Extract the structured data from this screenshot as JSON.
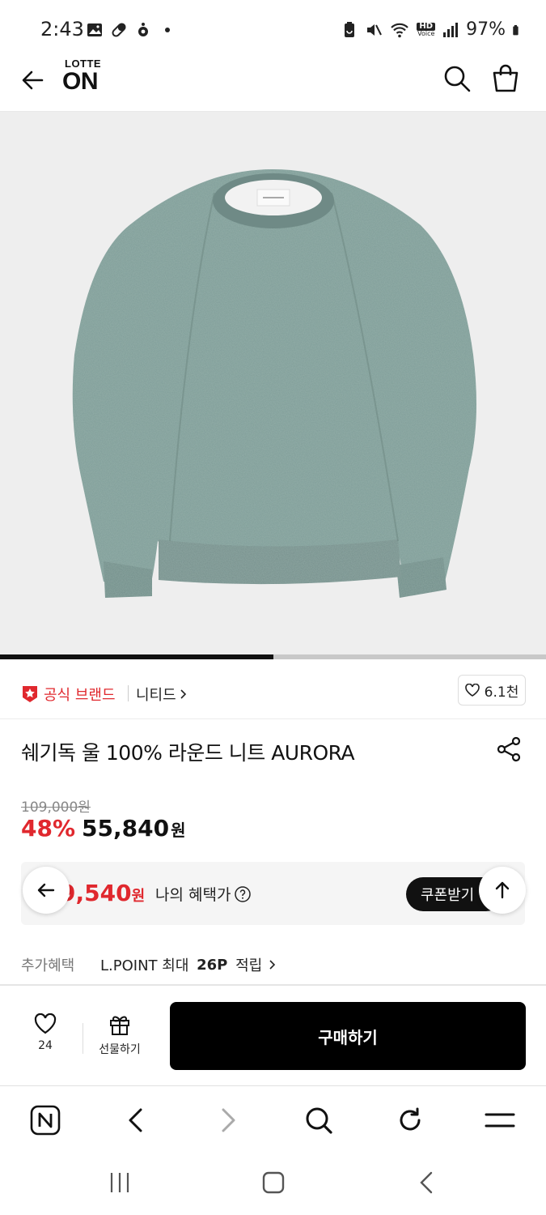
{
  "status_bar": {
    "time": "2:43",
    "battery": "97%",
    "icons": [
      "gallery-icon",
      "pill-icon",
      "app-notification-icon",
      "dot-icon",
      "battery-saver-icon",
      "mute-icon",
      "wifi-icon",
      "hd-voice-icon",
      "signal-icon",
      "battery-icon"
    ],
    "hd_voice_top": "HD",
    "hd_voice_bottom": "Voice"
  },
  "header": {
    "logo_top": "LOTTE",
    "logo_main": "ON",
    "icons": [
      "back-arrow-icon",
      "search-icon",
      "shopping-bag-icon"
    ]
  },
  "gallery": {
    "progress": 0.5,
    "colors": {
      "sweater": "#7f9c98",
      "background": "#eeeeee"
    }
  },
  "brand": {
    "official_label": "공식 브랜드",
    "brand_name": "니티드",
    "like_count": "6.1천"
  },
  "product": {
    "title": "쉐기독 울 100% 라운드 니트 AURORA"
  },
  "price": {
    "original": "109,000원",
    "discount": "48%",
    "sale": "55,840",
    "sale_unit": "원"
  },
  "benefit": {
    "price": "9,540",
    "unit": "원",
    "label": "나의 혜택가",
    "coupon_button": "쿠폰받기"
  },
  "extra": {
    "label": "추가혜택",
    "value_prefix": "L.POINT 최대 ",
    "value_bold": "26P",
    "value_suffix": " 적립"
  },
  "purchase_bar": {
    "wish_count": "24",
    "gift_label": "선물하기",
    "buy_label": "구매하기"
  },
  "colors": {
    "accent_red": "#e0282e",
    "black": "#111111"
  }
}
